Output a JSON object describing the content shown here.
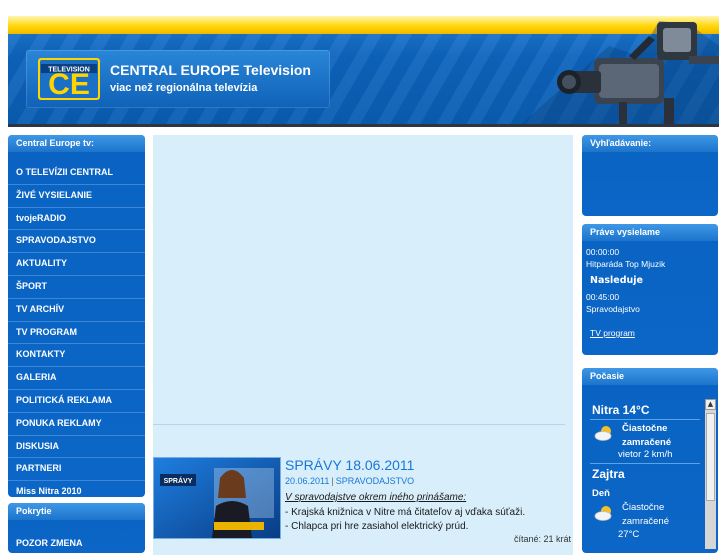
{
  "header": {
    "logo_tag": "TELEVISION",
    "logo_letters": "CE",
    "title": "CENTRAL EUROPE Television",
    "subtitle": "viac než regionálna televízia"
  },
  "left_menu": {
    "title": "Central Europe tv:",
    "items": [
      "O TELEVÍZII CENTRAL",
      "ŽIVÉ VYSIELANIE",
      "tvojeRADIO",
      "SPRAVODAJSTVO",
      "AKTUALITY",
      "ŠPORT",
      "TV ARCHÍV",
      "TV PROGRAM",
      "KONTAKTY",
      "GALERIA",
      "POLITICKÁ REKLAMA",
      "PONUKA REKLAMY",
      "DISKUSIA",
      "PARTNERI",
      "Miss Nitra 2010"
    ]
  },
  "coverage": {
    "title": "Pokrytie",
    "item": "POZOR ZMENA"
  },
  "search": {
    "title": "Vyhľadávanie:"
  },
  "now_playing": {
    "title": "Práve vysielame",
    "now_time": "00:00:00",
    "now_show": "Hitparáda Top Mjuzik",
    "next_title": "Nasleduje",
    "next_time": "00:45:00",
    "next_show": "Spravodajstvo",
    "program_link": "TV program"
  },
  "weather": {
    "title": "Počasie",
    "city": "Nitra 14°C",
    "today_condition": "Čiastočne zamračené",
    "today_wind": "vietor 2 km/h",
    "tomorrow_label": "Zajtra",
    "day_label": "Deň",
    "tomorrow_condition": "Čiastočne zamračené",
    "tomorrow_temp": "27°C"
  },
  "article": {
    "thumb_label": "SPRÁVY",
    "title": "SPRÁVY 18.06.2011",
    "date": "20.06.2011",
    "category": "SPRAVODAJSTVO",
    "intro": "V spravodajstve okrem iného prinášame:",
    "bullets": [
      "- Krajská knižnica v Nitre má čitateľov aj vďaka súťaži.",
      "- Chlapca pri hre zasiahol elektrický prúd."
    ],
    "reads": "čítané: 21 krát"
  },
  "colors": {
    "brand_blue": "#0a63c2",
    "brand_yellow": "#ffd400",
    "content_bg": "#d9eefb",
    "link_blue": "#1877d6"
  }
}
